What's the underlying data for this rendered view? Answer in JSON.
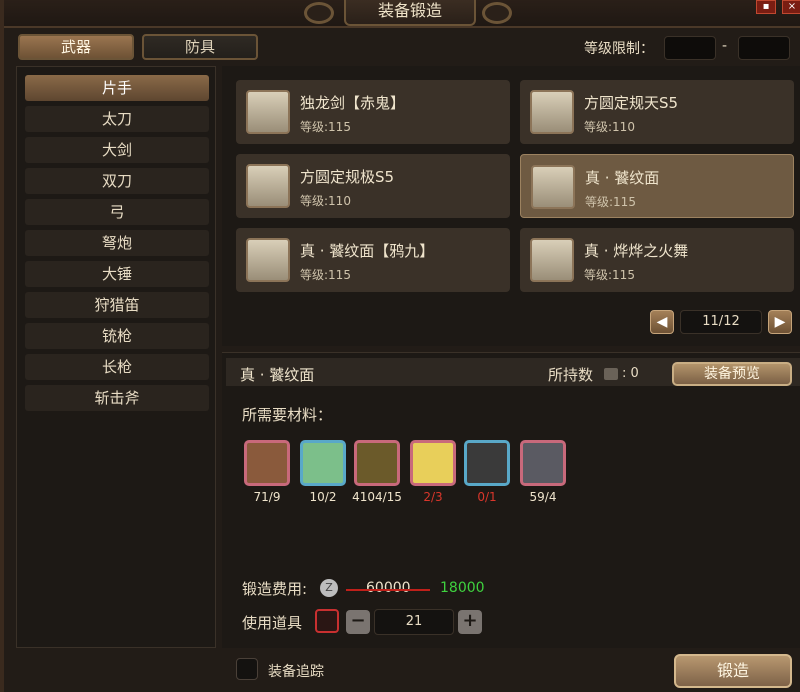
{
  "window": {
    "title": "装备锻造",
    "close_glyph": "×"
  },
  "tabs": [
    {
      "label": "武器",
      "active": true
    },
    {
      "label": "防具",
      "active": false
    }
  ],
  "level_limit": {
    "label": "等级限制：",
    "min": "",
    "max": "",
    "separator": "-"
  },
  "categories": [
    {
      "label": "片手",
      "selected": true
    },
    {
      "label": "太刀",
      "selected": false
    },
    {
      "label": "大剑",
      "selected": false
    },
    {
      "label": "双刀",
      "selected": false
    },
    {
      "label": "弓",
      "selected": false
    },
    {
      "label": "弩炮",
      "selected": false
    },
    {
      "label": "大锤",
      "selected": false
    },
    {
      "label": "狩猎笛",
      "selected": false
    },
    {
      "label": "铳枪",
      "selected": false
    },
    {
      "label": "长枪",
      "selected": false
    },
    {
      "label": "斩击斧",
      "selected": false
    }
  ],
  "equipment": [
    {
      "name": "独龙剑【赤鬼】",
      "level": "等级:115",
      "icon": "red-sword-icon",
      "selected": false
    },
    {
      "name": "方圆定规天S5",
      "level": "等级:110",
      "icon": "ruler-shield-icon",
      "selected": false
    },
    {
      "name": "方圆定规极S5",
      "level": "等级:110",
      "icon": "ruler-shield-icon",
      "selected": false
    },
    {
      "name": "真 · 饕纹面",
      "level": "等级:115",
      "icon": "dark-blade-icon",
      "selected": true
    },
    {
      "name": "真 · 饕纹面【鸦九】",
      "level": "等级:115",
      "icon": "crimson-blade-icon",
      "selected": false
    },
    {
      "name": "真 · 烨烨之火舞",
      "level": "等级:115",
      "icon": "golden-flame-icon",
      "selected": false
    }
  ],
  "pagination": {
    "text": "11/12",
    "prev": "◀",
    "next": "▶"
  },
  "detail": {
    "name": "真 · 饕纹面",
    "owned_label": "所持数",
    "owned_value": ": 0",
    "preview_label": "装备预览",
    "materials_title": "所需要材料：",
    "materials": [
      {
        "count": "71/9",
        "icon": "shell-scale-icon",
        "border": "pink",
        "enough": true
      },
      {
        "count": "10/2",
        "icon": "green-wyvern-icon",
        "border": "blue",
        "enough": true
      },
      {
        "count": "4104/15",
        "icon": "golden-spine-icon",
        "border": "pink",
        "enough": true
      },
      {
        "count": "2/3",
        "icon": "yellow-hide-icon",
        "border": "pink",
        "enough": false
      },
      {
        "count": "0/1",
        "icon": "dark-orb-icon",
        "border": "blue",
        "enough": false
      },
      {
        "count": "59/4",
        "icon": "beast-skull-icon",
        "border": "pink",
        "enough": true
      }
    ],
    "cost_label": "锻造费用:",
    "zeny_glyph": "Z",
    "old_cost": "60000",
    "new_cost": "18000",
    "tool_label": "使用道具",
    "tool_quantity": "21",
    "minus": "−",
    "plus": "+"
  },
  "footer": {
    "track_label": "装备追踪",
    "forge_label": "锻造"
  },
  "colors": {
    "accent_gold": "#9a7550",
    "selected_card": "#6e5a42",
    "discount_green": "#3fd23f",
    "insufficient_red": "#d9362b"
  }
}
